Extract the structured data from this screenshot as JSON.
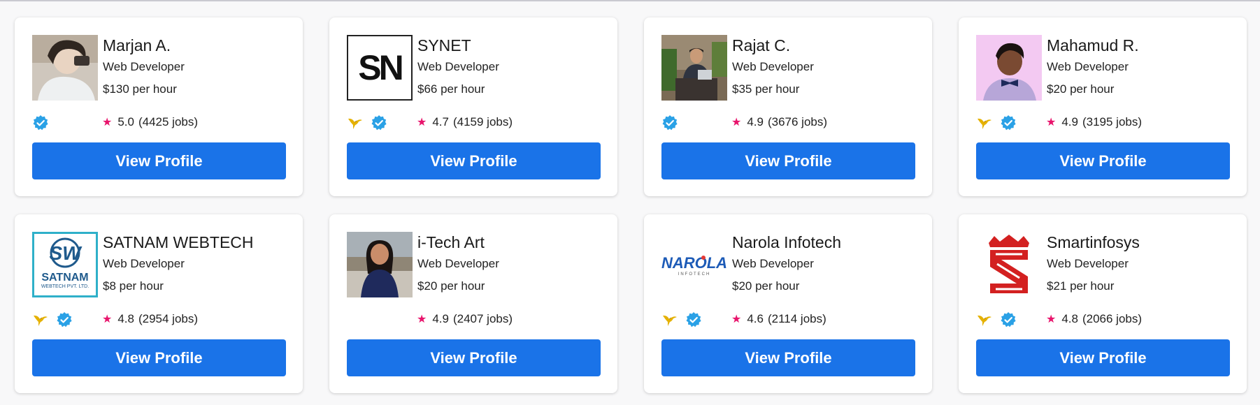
{
  "cards": [
    {
      "name": "Marjan A.",
      "role": "Web Developer",
      "rate": "$130 per hour",
      "rating": "5.0",
      "jobs": "(4425 jobs)",
      "button": "View Profile"
    },
    {
      "name": "SYNET",
      "role": "Web Developer",
      "rate": "$66 per hour",
      "rating": "4.7",
      "jobs": "(4159 jobs)",
      "button": "View Profile",
      "logo_text": "SN"
    },
    {
      "name": "Rajat C.",
      "role": "Web Developer",
      "rate": "$35 per hour",
      "rating": "4.9",
      "jobs": "(3676 jobs)",
      "button": "View Profile"
    },
    {
      "name": "Mahamud R.",
      "role": "Web Developer",
      "rate": "$20 per hour",
      "rating": "4.9",
      "jobs": "(3195 jobs)",
      "button": "View Profile"
    },
    {
      "name": "SATNAM WEBTECH",
      "role": "Web Developer",
      "rate": "$8 per hour",
      "rating": "4.8",
      "jobs": "(2954 jobs)",
      "button": "View Profile",
      "logo_text": "SATNAM",
      "logo_sub": "WEBTECH PVT. LTD."
    },
    {
      "name": "i-Tech Art",
      "role": "Web Developer",
      "rate": "$20 per hour",
      "rating": "4.9",
      "jobs": "(2407 jobs)",
      "button": "View Profile"
    },
    {
      "name": "Narola Infotech",
      "role": "Web Developer",
      "rate": "$20 per hour",
      "rating": "4.6",
      "jobs": "(2114 jobs)",
      "button": "View Profile",
      "logo_text": "NAROLA",
      "logo_sub": "INFOTECH"
    },
    {
      "name": "Smartinfosys",
      "role": "Web Developer",
      "rate": "$21 per hour",
      "rating": "4.8",
      "jobs": "(2066 jobs)",
      "button": "View Profile"
    }
  ],
  "colors": {
    "accent": "#1a73e8",
    "star": "#e8146c",
    "verified": "#2aa1e6",
    "bird": "#e5b100"
  }
}
